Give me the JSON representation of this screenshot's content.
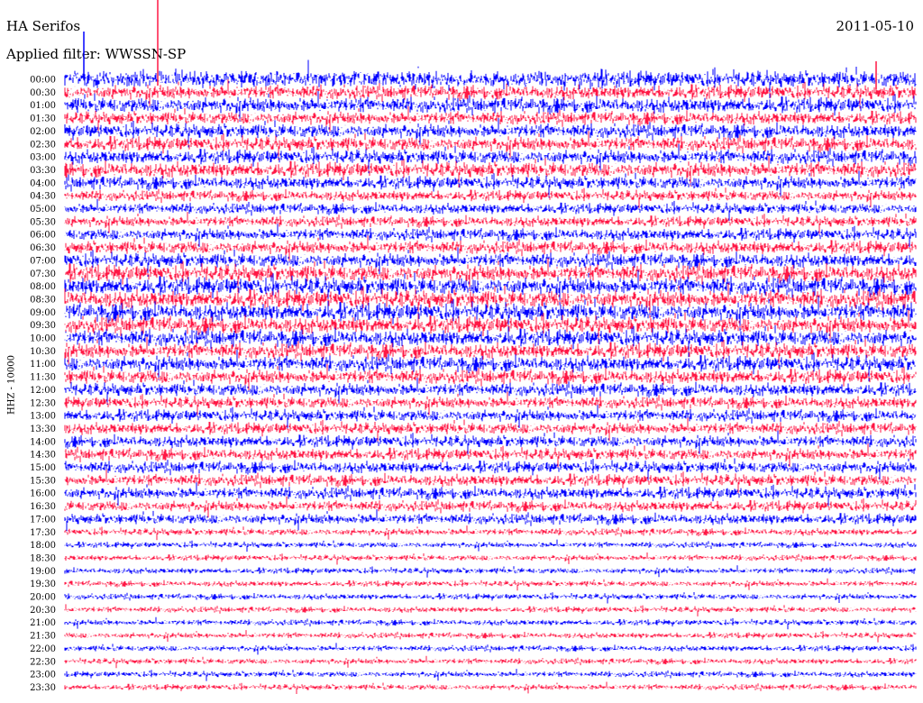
{
  "header": {
    "station": "HA Serifos",
    "filter_label": "Applied filter: WWSSN-SP",
    "date": "2011-05-10"
  },
  "chart_data": {
    "type": "line",
    "title": "HA Serifos",
    "subtitle": "Applied filter: WWSSN-SP",
    "date": "2011-05-10",
    "ylabel": "HHZ - 10000",
    "row_labels": [
      "00:00",
      "00:30",
      "01:00",
      "01:30",
      "02:00",
      "02:30",
      "03:00",
      "03:30",
      "04:00",
      "04:30",
      "05:00",
      "05:30",
      "06:00",
      "06:30",
      "07:00",
      "07:30",
      "08:00",
      "08:30",
      "09:00",
      "09:30",
      "10:00",
      "10:30",
      "11:00",
      "11:30",
      "12:00",
      "12:30",
      "13:00",
      "13:30",
      "14:00",
      "14:30",
      "15:00",
      "15:30",
      "16:00",
      "16:30",
      "17:00",
      "17:30",
      "18:00",
      "18:30",
      "19:00",
      "19:30",
      "20:00",
      "20:30",
      "21:00",
      "21:30",
      "22:00",
      "22:30",
      "23:00",
      "23:30"
    ],
    "series_colors": [
      "#0000ff",
      "#ff1744"
    ],
    "row_amplitude": [
      14,
      12,
      13,
      11,
      12,
      12,
      12,
      13,
      11,
      9,
      9,
      9,
      10,
      11,
      12,
      14,
      15,
      15,
      15,
      14,
      14,
      13,
      13,
      12,
      11,
      10,
      10,
      10,
      10,
      10,
      10,
      10,
      10,
      9,
      9,
      6,
      5,
      5,
      5,
      5,
      5,
      5,
      5,
      5,
      5,
      5,
      5,
      5
    ],
    "grid": false
  }
}
